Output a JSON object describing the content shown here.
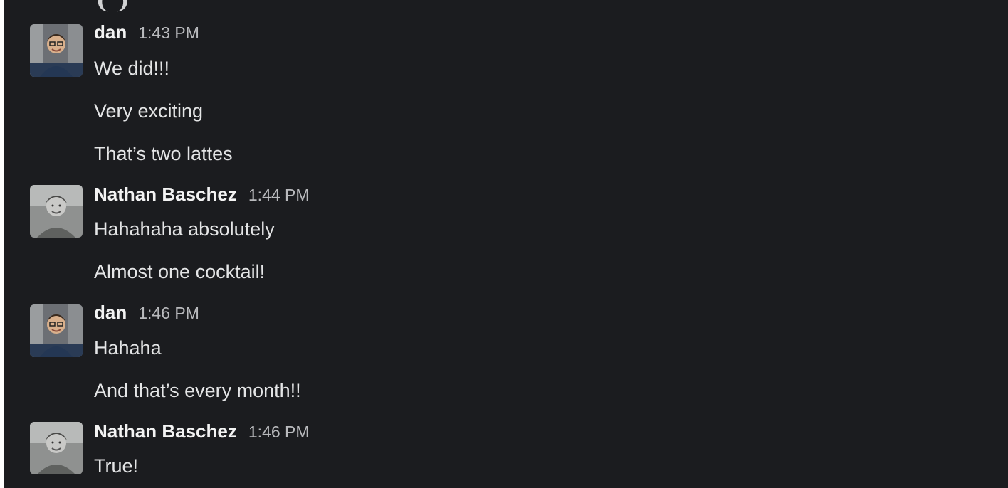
{
  "messages": [
    {
      "author": "dan",
      "time": "1:43 PM",
      "avatar_icon": "dan-avatar",
      "lines": [
        "We did!!!",
        "Very exciting",
        "That’s two lattes"
      ]
    },
    {
      "author": "Nathan Baschez",
      "time": "1:44 PM",
      "avatar_icon": "nathan-avatar",
      "lines": [
        "Hahahaha absolutely",
        "Almost one cocktail!"
      ]
    },
    {
      "author": "dan",
      "time": "1:46 PM",
      "avatar_icon": "dan-avatar",
      "lines": [
        "Hahaha",
        "And that’s every month!!"
      ]
    },
    {
      "author": "Nathan Baschez",
      "time": "1:46 PM",
      "avatar_icon": "nathan-avatar",
      "lines": [
        "True!"
      ]
    }
  ],
  "colors": {
    "background": "#1b1c1f",
    "author_text": "#f3f3f3",
    "timestamp_text": "#b9babd",
    "message_text": "#e4e5e6"
  }
}
